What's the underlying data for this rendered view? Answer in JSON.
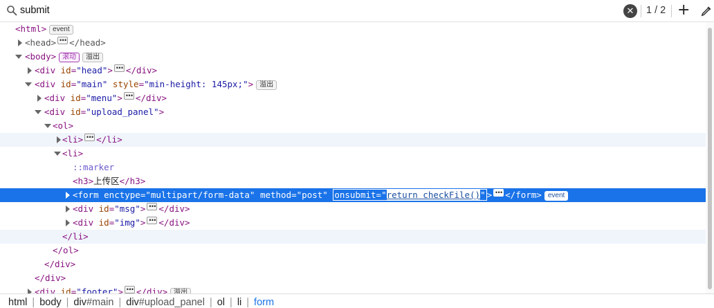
{
  "search": {
    "query": "submit",
    "match_count": "1 / 2"
  },
  "tree": {
    "html_open": "<html>",
    "html_badge": "event",
    "head_open": "<head>",
    "head_close": "</head>",
    "body_open": "<body>",
    "body_badge1": "滚动",
    "body_badge2": "溢出",
    "div_head_tag": "<div ",
    "div_head_attr": "id",
    "div_head_val": "\"head\"",
    "div_head_close": "</div>",
    "div_main_tag": "<div ",
    "div_main_attr1": "id",
    "div_main_val1": "\"main\"",
    "div_main_attr2": "style",
    "div_main_val2": "\"min-height: 145px;\"",
    "div_main_badge": "溢出",
    "div_menu_tag": "<div ",
    "div_menu_attr": "id",
    "div_menu_val": "\"menu\"",
    "div_menu_close": "</div>",
    "div_upload_tag": "<div ",
    "div_upload_attr": "id",
    "div_upload_val": "\"upload_panel\"",
    "ol_open": "<ol>",
    "li1_open": "<li>",
    "li1_close": "</li>",
    "li2_open": "<li>",
    "marker": "::marker",
    "h3_open": "<h3>",
    "h3_text": "上传区",
    "h3_close": "</h3>",
    "form_tag": "<form ",
    "form_attr1": "enctype",
    "form_val1": "\"multipart/form-data\"",
    "form_attr2": "method",
    "form_val2": "\"post\"",
    "form_attr3": "onsubmit",
    "form_val3": "return checkFile()",
    "form_close": "</form>",
    "form_badge": "event",
    "div_msg_tag": "<div ",
    "div_msg_attr": "id",
    "div_msg_val": "\"msg\"",
    "div_msg_close": "</div>",
    "div_img_tag": "<div ",
    "div_img_attr": "id",
    "div_img_val": "\"img\"",
    "div_img_close": "</div>",
    "li2_close": "</li>",
    "ol_close": "</ol>",
    "div_close1": "</div>",
    "div_close2": "</div>",
    "div_footer_tag": "<div ",
    "div_footer_attr": "id",
    "div_footer_val": "\"footer\"",
    "div_footer_close": "</div>",
    "div_footer_badge": "溢出"
  },
  "breadcrumb": {
    "html": "html",
    "body": "body",
    "main_tag": "div",
    "main_id": "#main",
    "upload_tag": "div",
    "upload_id": "#upload_panel",
    "ol": "ol",
    "li": "li",
    "form": "form"
  },
  "colors": {
    "selection": "#1a73e8",
    "tag": "#881280",
    "attr_name": "#994500",
    "attr_value": "#1a1aa6"
  },
  "icons": [
    "search-icon",
    "clear-search-icon",
    "add-rule-icon",
    "element-picker-icon",
    "expand-triangle-icon",
    "collapse-triangle-icon",
    "ellipsis-icon"
  ]
}
